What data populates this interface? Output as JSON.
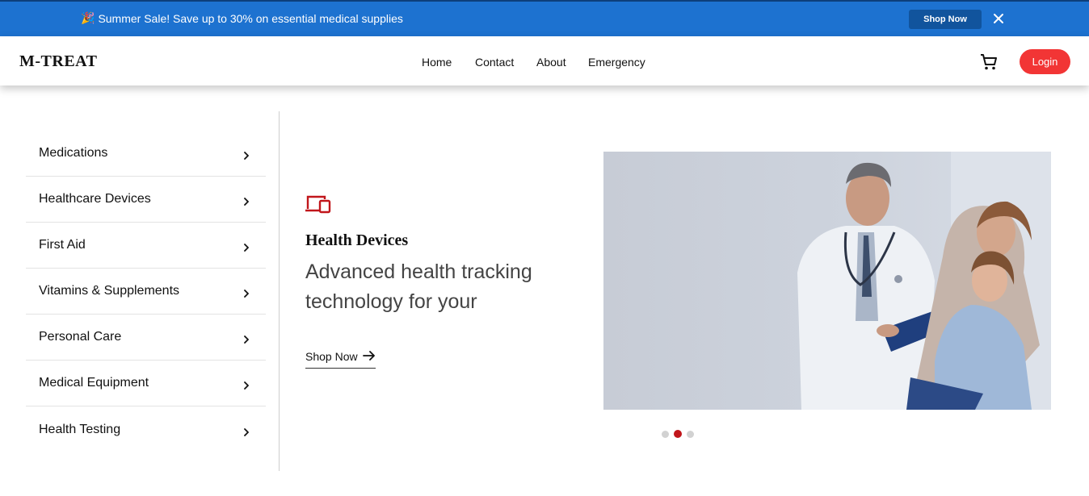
{
  "promo": {
    "icon": "party-popper-icon",
    "text": "Summer Sale! Save up to 30% on essential medical supplies",
    "shop_label": "Shop Now",
    "close_icon": "close-icon",
    "bg_color": "#1d72d0"
  },
  "nav": {
    "logo": "M-TREAT",
    "links": [
      "Home",
      "Contact",
      "About",
      "Emergency"
    ],
    "cart_icon": "cart-icon",
    "login_label": "Login",
    "login_color": "#f23535"
  },
  "sidebar": {
    "items": [
      {
        "label": "Medications"
      },
      {
        "label": "Healthcare Devices"
      },
      {
        "label": "First Aid"
      },
      {
        "label": "Vitamins & Supplements"
      },
      {
        "label": "Personal Care"
      },
      {
        "label": "Medical Equipment"
      },
      {
        "label": "Health Testing"
      }
    ],
    "chevron_icon": "chevron-right-icon"
  },
  "hero": {
    "icon": "devices-icon",
    "title": "Health Devices",
    "subtitle": "Advanced health tracking technology for your",
    "shop_label": "Shop Now",
    "arrow_icon": "arrow-right-icon",
    "image": "doctor-with-patient-photo",
    "slides": 3,
    "active_slide": 2,
    "accent_color": "#c1161b"
  }
}
